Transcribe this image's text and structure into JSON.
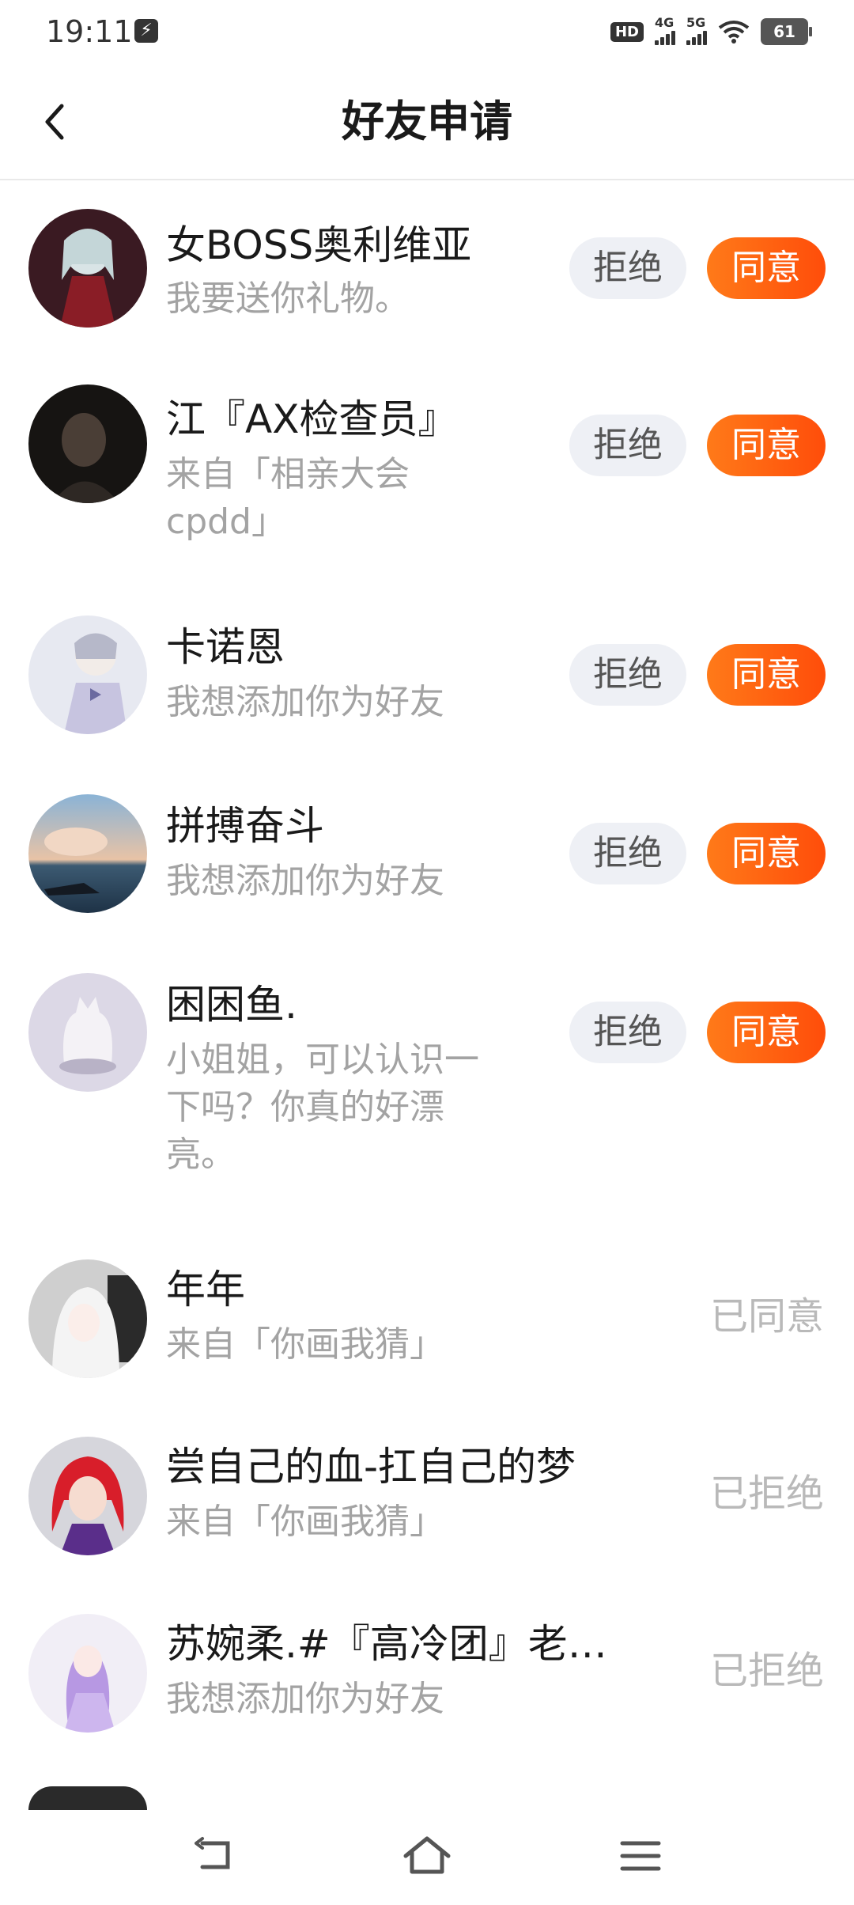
{
  "status_bar": {
    "time": "19:11",
    "hd": "HD",
    "net1": "4G",
    "net2": "5G",
    "battery": "61"
  },
  "header": {
    "title": "好友申请"
  },
  "actions": {
    "reject": "拒绝",
    "agree": "同意"
  },
  "requests": [
    {
      "name": "女BOSS奥利维亚",
      "message": "我要送你礼物。",
      "status": "pending",
      "avatar_icon": "avatar-gothic-girl"
    },
    {
      "name": "江『AX检查员』",
      "message": "来自「相亲大会cpdd」",
      "message_line1": "来自「相亲大会",
      "message_line2": "cpdd」",
      "status": "pending",
      "avatar_icon": "avatar-dark-photo"
    },
    {
      "name": "卡诺恩",
      "message": "我想添加你为好友",
      "status": "pending",
      "avatar_icon": "avatar-anime-boy"
    },
    {
      "name": "拼搏奋斗",
      "message": "我想添加你为好友",
      "status": "pending",
      "avatar_icon": "avatar-sea-sunset"
    },
    {
      "name": "困困鱼.",
      "message": "小姐姐，可以认识一下吗？你真的好漂亮。",
      "message_line1": "小姐姐，可以认识一",
      "message_line2": "下吗？你真的好漂",
      "message_line3": "亮。",
      "status": "pending",
      "avatar_icon": "avatar-white-cat"
    },
    {
      "name": "年年",
      "message": "来自「你画我猜」",
      "status": "已同意",
      "avatar_icon": "avatar-white-hair"
    },
    {
      "name": "尝自己的血-扛自己的梦",
      "message": "来自「你画我猜」",
      "status": "已拒绝",
      "avatar_icon": "avatar-red-hair"
    },
    {
      "name": "苏婉柔.#『高冷团』老…",
      "message": "我想添加你为好友",
      "status": "已拒绝",
      "avatar_icon": "avatar-purple-girl"
    }
  ],
  "colors": {
    "agree": "#ff5a0f",
    "reject_bg": "#eef0f5",
    "secondary_text": "#a3a3a3",
    "state_text": "#b9b9b9"
  }
}
